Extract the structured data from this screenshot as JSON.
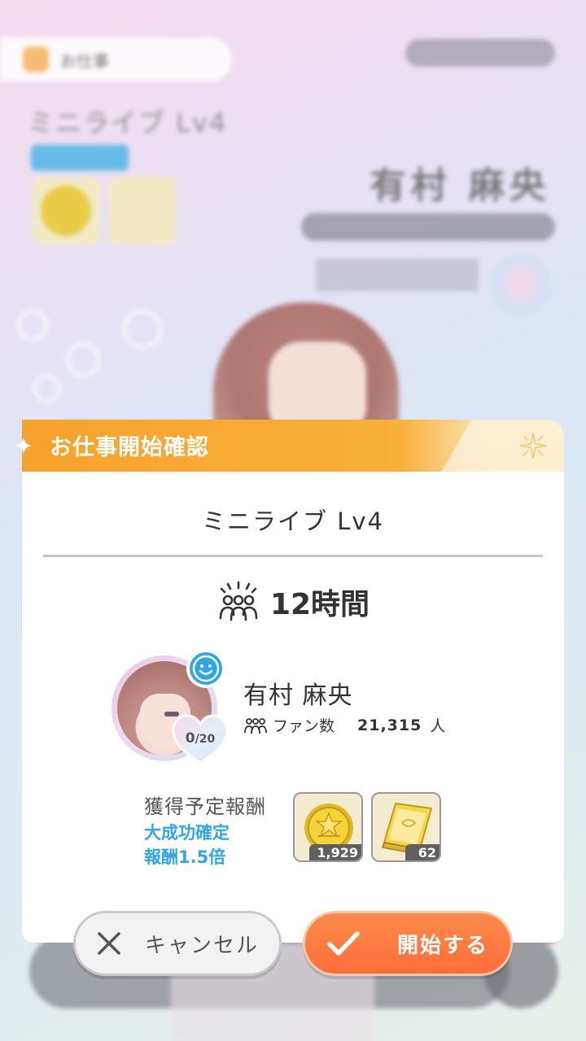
{
  "background": {
    "topbar_label": "お仕事",
    "job_title": "ミニライブ Lv4",
    "idol_name": "有村 麻央"
  },
  "dialog": {
    "header_title": "お仕事開始確認",
    "job_title": "ミニライブ Lv4",
    "duration": "12時間",
    "idol": {
      "name": "有村 麻央",
      "fans_label": "ファン数",
      "fans_value": "21,315",
      "fans_unit": "人",
      "affection_current": "0",
      "affection_max": "20"
    },
    "reward": {
      "label": "獲得予定報酬",
      "bonus_line1": "大成功確定",
      "bonus_line2": "報酬1.5倍",
      "items": [
        {
          "icon": "coin-icon",
          "count": "1,929"
        },
        {
          "icon": "book-icon",
          "count": "62"
        }
      ]
    }
  },
  "buttons": {
    "cancel": "キャンセル",
    "start": "開始する"
  },
  "colors": {
    "header_orange": "#f6a22c",
    "start_button": "#ff7a40",
    "bonus_blue": "#2ea6e8"
  }
}
